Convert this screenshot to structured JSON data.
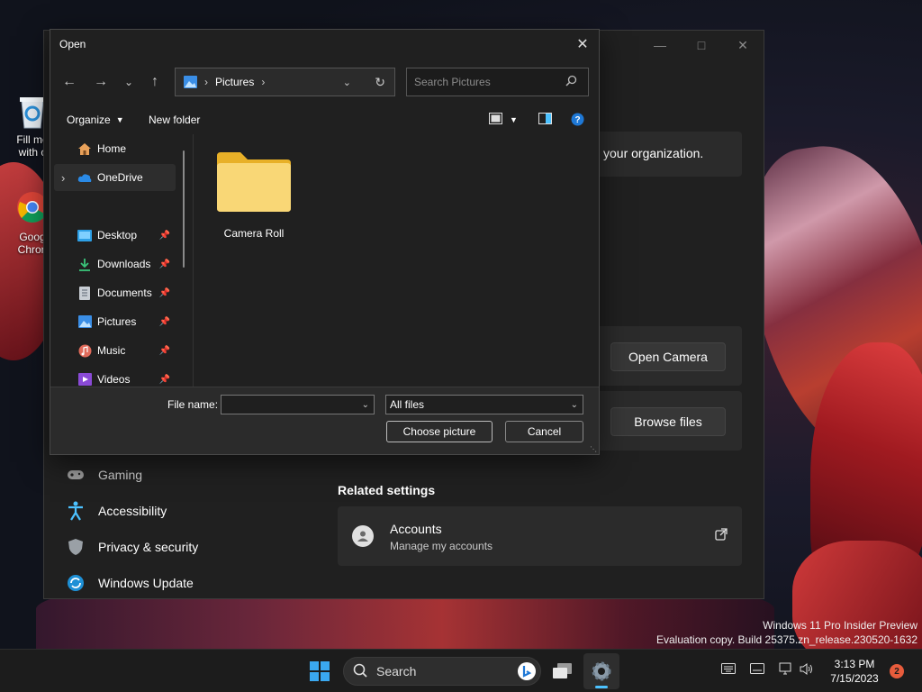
{
  "desktop": {
    "icons": [
      {
        "label": "Fill me with c",
        "icon": "recycle-bin-icon"
      },
      {
        "label": "Goog Chron",
        "icon": "chrome-icon"
      }
    ],
    "watermark_line1": "Windows 11 Pro Insider Preview",
    "watermark_line2": "Evaluation copy. Build 25375.zn_release.230520-1632"
  },
  "settings": {
    "org_text": "your organization.",
    "open_camera": "Open Camera",
    "browse_files": "Browse files",
    "related_settings": "Related settings",
    "accounts_title": "Accounts",
    "accounts_sub": "Manage my accounts",
    "nav": [
      {
        "label": "Gaming",
        "icon": "gaming-icon"
      },
      {
        "label": "Accessibility",
        "icon": "accessibility-icon"
      },
      {
        "label": "Privacy & security",
        "icon": "shield-icon"
      },
      {
        "label": "Windows Update",
        "icon": "windows-update-icon"
      }
    ]
  },
  "dialog": {
    "title": "Open",
    "address": {
      "segment": "Pictures"
    },
    "search_placeholder": "Search Pictures",
    "toolbar": {
      "organize": "Organize",
      "new_folder": "New folder"
    },
    "sidebar": [
      {
        "label": "Home",
        "icon": "home-icon",
        "pinned": false
      },
      {
        "label": "OneDrive",
        "icon": "onedrive-icon",
        "pinned": false
      },
      {
        "label": "Desktop",
        "icon": "desktop-folder-icon",
        "pinned": true
      },
      {
        "label": "Downloads",
        "icon": "downloads-icon",
        "pinned": true
      },
      {
        "label": "Documents",
        "icon": "documents-icon",
        "pinned": true
      },
      {
        "label": "Pictures",
        "icon": "pictures-icon",
        "pinned": true
      },
      {
        "label": "Music",
        "icon": "music-icon",
        "pinned": true
      },
      {
        "label": "Videos",
        "icon": "videos-icon",
        "pinned": true
      }
    ],
    "items": [
      {
        "label": "Camera Roll",
        "icon": "folder-icon"
      }
    ],
    "file_name_label": "File name:",
    "file_name_value": "",
    "filter_value": "All files",
    "choose_button": "Choose picture",
    "cancel_button": "Cancel"
  },
  "taskbar": {
    "search_label": "Search",
    "time": "3:13 PM",
    "date": "7/15/2023",
    "notification_count": "2"
  },
  "colors": {
    "accent": "#4cc2ff",
    "folder": "#f5c542",
    "badge": "#e85c3c"
  }
}
